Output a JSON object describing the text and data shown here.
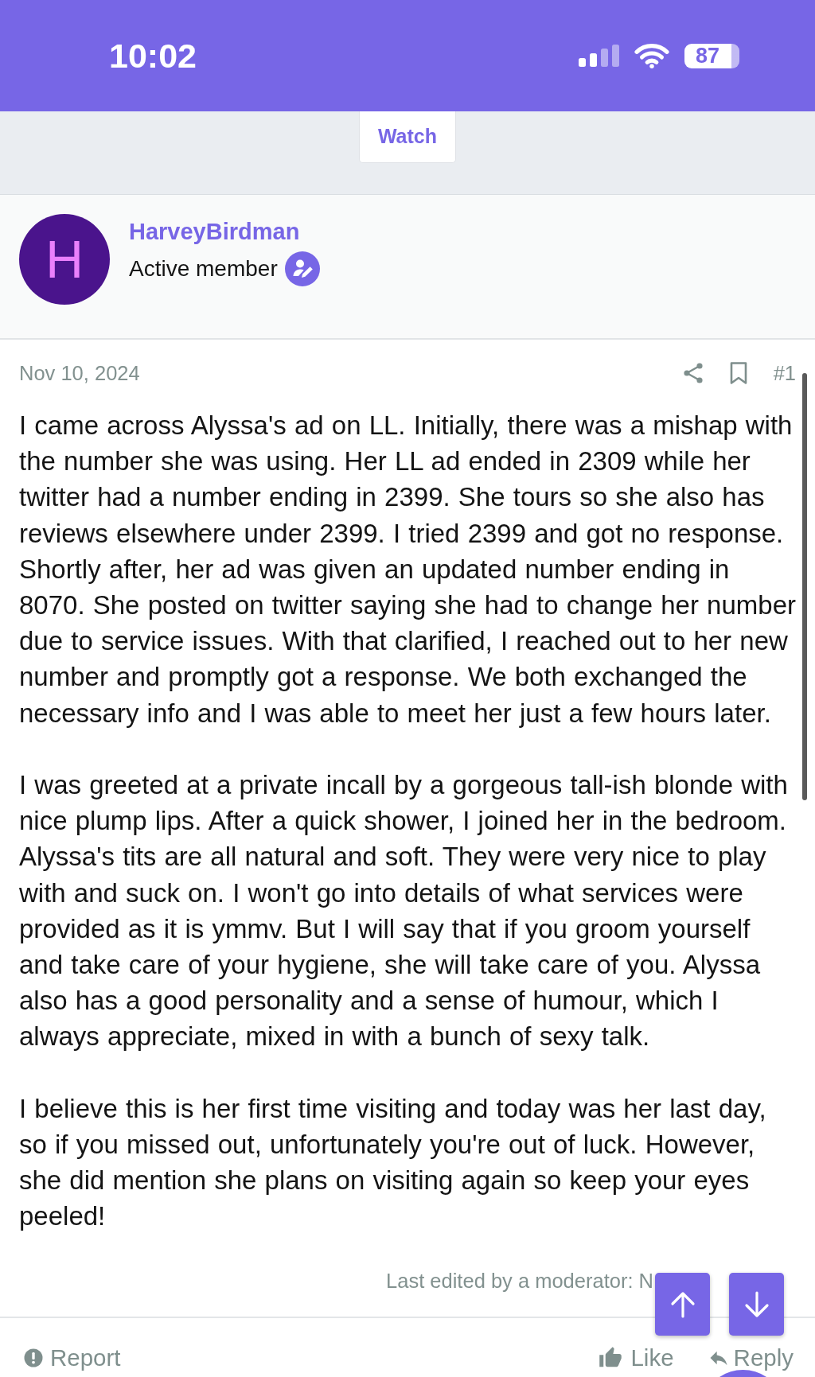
{
  "status_bar": {
    "time": "10:02",
    "battery": "87"
  },
  "toolbar": {
    "watch_button": "Watch"
  },
  "author": {
    "initial": "H",
    "name": "HarveyBirdman",
    "title": "Active member"
  },
  "post": {
    "date": "Nov 10, 2024",
    "number": "#1",
    "paragraphs": [
      "I came across Alyssa's ad on LL. Initially, there was a mishap with the number she was using. Her LL ad ended in 2309 while her twitter had a number ending in 2399. She tours so she also has reviews elsewhere under 2399. I tried 2399 and got no response. Shortly after, her ad was given an updated number ending in 8070. She posted on twitter saying she had to change her number due to service issues. With that clarified, I reached out to her new number and promptly got a response. We both exchanged the necessary info and I was able to meet her just a few hours later.",
      "I was greeted at a private incall by a gorgeous tall-ish blonde with nice plump lips. After a quick shower, I joined her in the bedroom. Alyssa's tits are all natural and soft. They were very nice to play with and suck on. I won't go into details of what services were provided as it is ymmv. But I will say that if you groom yourself and take care of your hygiene, she will take care of you. Alyssa also has a good personality and a sense of humour, which I always appreciate, mixed in with a bunch of sexy talk.",
      "I believe this is her first time visiting and today was her last day, so if you missed out, unfortunately you're out of luck. However, she did mention she plans on visiting again so keep your eyes peeled!"
    ],
    "edit_note": "Last edited by a moderator: N"
  },
  "actions": {
    "left": [
      {
        "kind": "report",
        "label": "Report"
      }
    ],
    "right": [
      {
        "kind": "like",
        "label": "Like"
      },
      {
        "kind": "reply",
        "label": "Reply"
      }
    ]
  }
}
